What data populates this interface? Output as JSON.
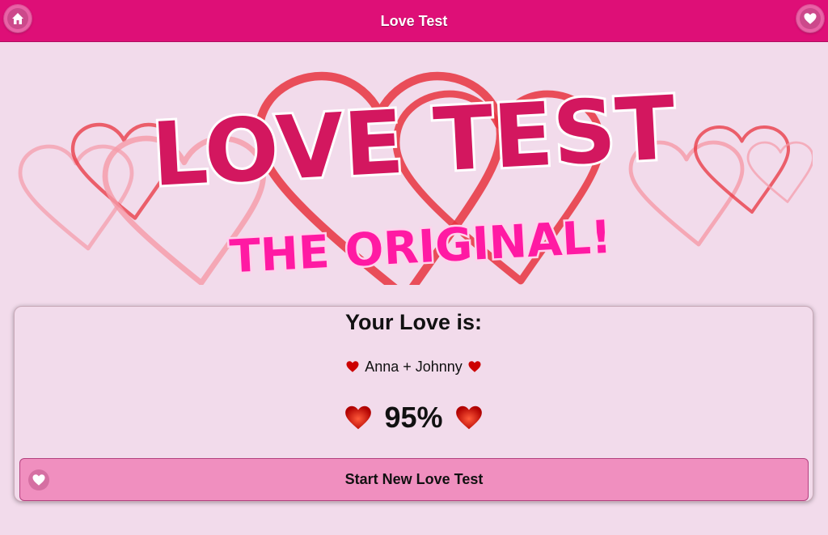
{
  "header": {
    "title": "Love Test",
    "home_icon": "home-icon",
    "favorite_icon": "heart-icon"
  },
  "banner": {
    "logo_line1": "LOVE TEST",
    "logo_line2": "THE ORIGINAL!"
  },
  "result": {
    "heading": "Your Love is:",
    "names": "Anna + Johnny",
    "percent": "95%"
  },
  "actions": {
    "new_test_label": "Start New Love Test",
    "new_test_icon": "heart-icon"
  },
  "colors": {
    "header_bg": "#de0f77",
    "page_bg": "#f2dbeb",
    "button_bg": "#f08fbf",
    "logo_main": "#d3175f",
    "logo_sub": "#ff1aa3"
  }
}
